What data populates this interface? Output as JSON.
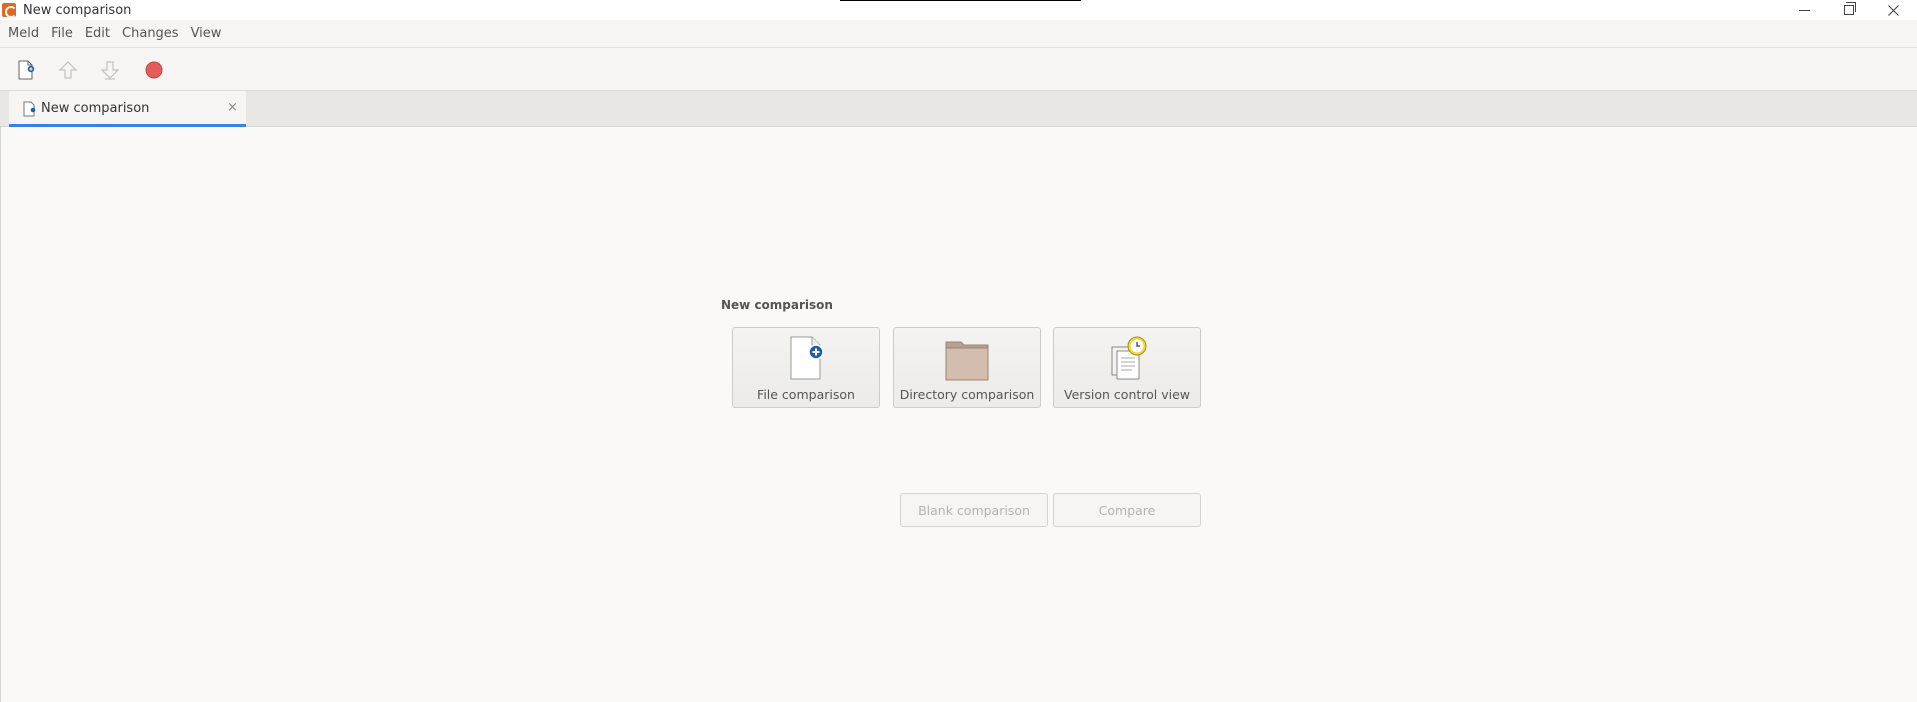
{
  "window": {
    "title": "New comparison",
    "controls": [
      "minimize",
      "maximize",
      "close"
    ]
  },
  "menu": [
    "Meld",
    "File",
    "Edit",
    "Changes",
    "View"
  ],
  "toolbar": {
    "buttons": [
      {
        "name": "new-comparison",
        "icon": "new-document-icon",
        "enabled": true
      },
      {
        "name": "previous-change",
        "icon": "arrow-up-icon",
        "enabled": false
      },
      {
        "name": "next-change",
        "icon": "arrow-down-icon",
        "enabled": false
      },
      {
        "name": "stop",
        "icon": "stop-icon",
        "enabled": true,
        "color": "#e35d5b"
      }
    ]
  },
  "tabs": [
    {
      "label": "New comparison",
      "active": true,
      "close": "×"
    }
  ],
  "accent_color": "#3584e4",
  "main": {
    "section_title": "New comparison",
    "cards": [
      {
        "label": "File comparison",
        "icon": "file-plus-icon"
      },
      {
        "label": "Directory comparison",
        "icon": "folder-icon"
      },
      {
        "label": "Version control view",
        "icon": "version-control-icon"
      }
    ],
    "actions": [
      {
        "label": "Blank comparison",
        "enabled": false
      },
      {
        "label": "Compare",
        "enabled": false
      }
    ]
  }
}
